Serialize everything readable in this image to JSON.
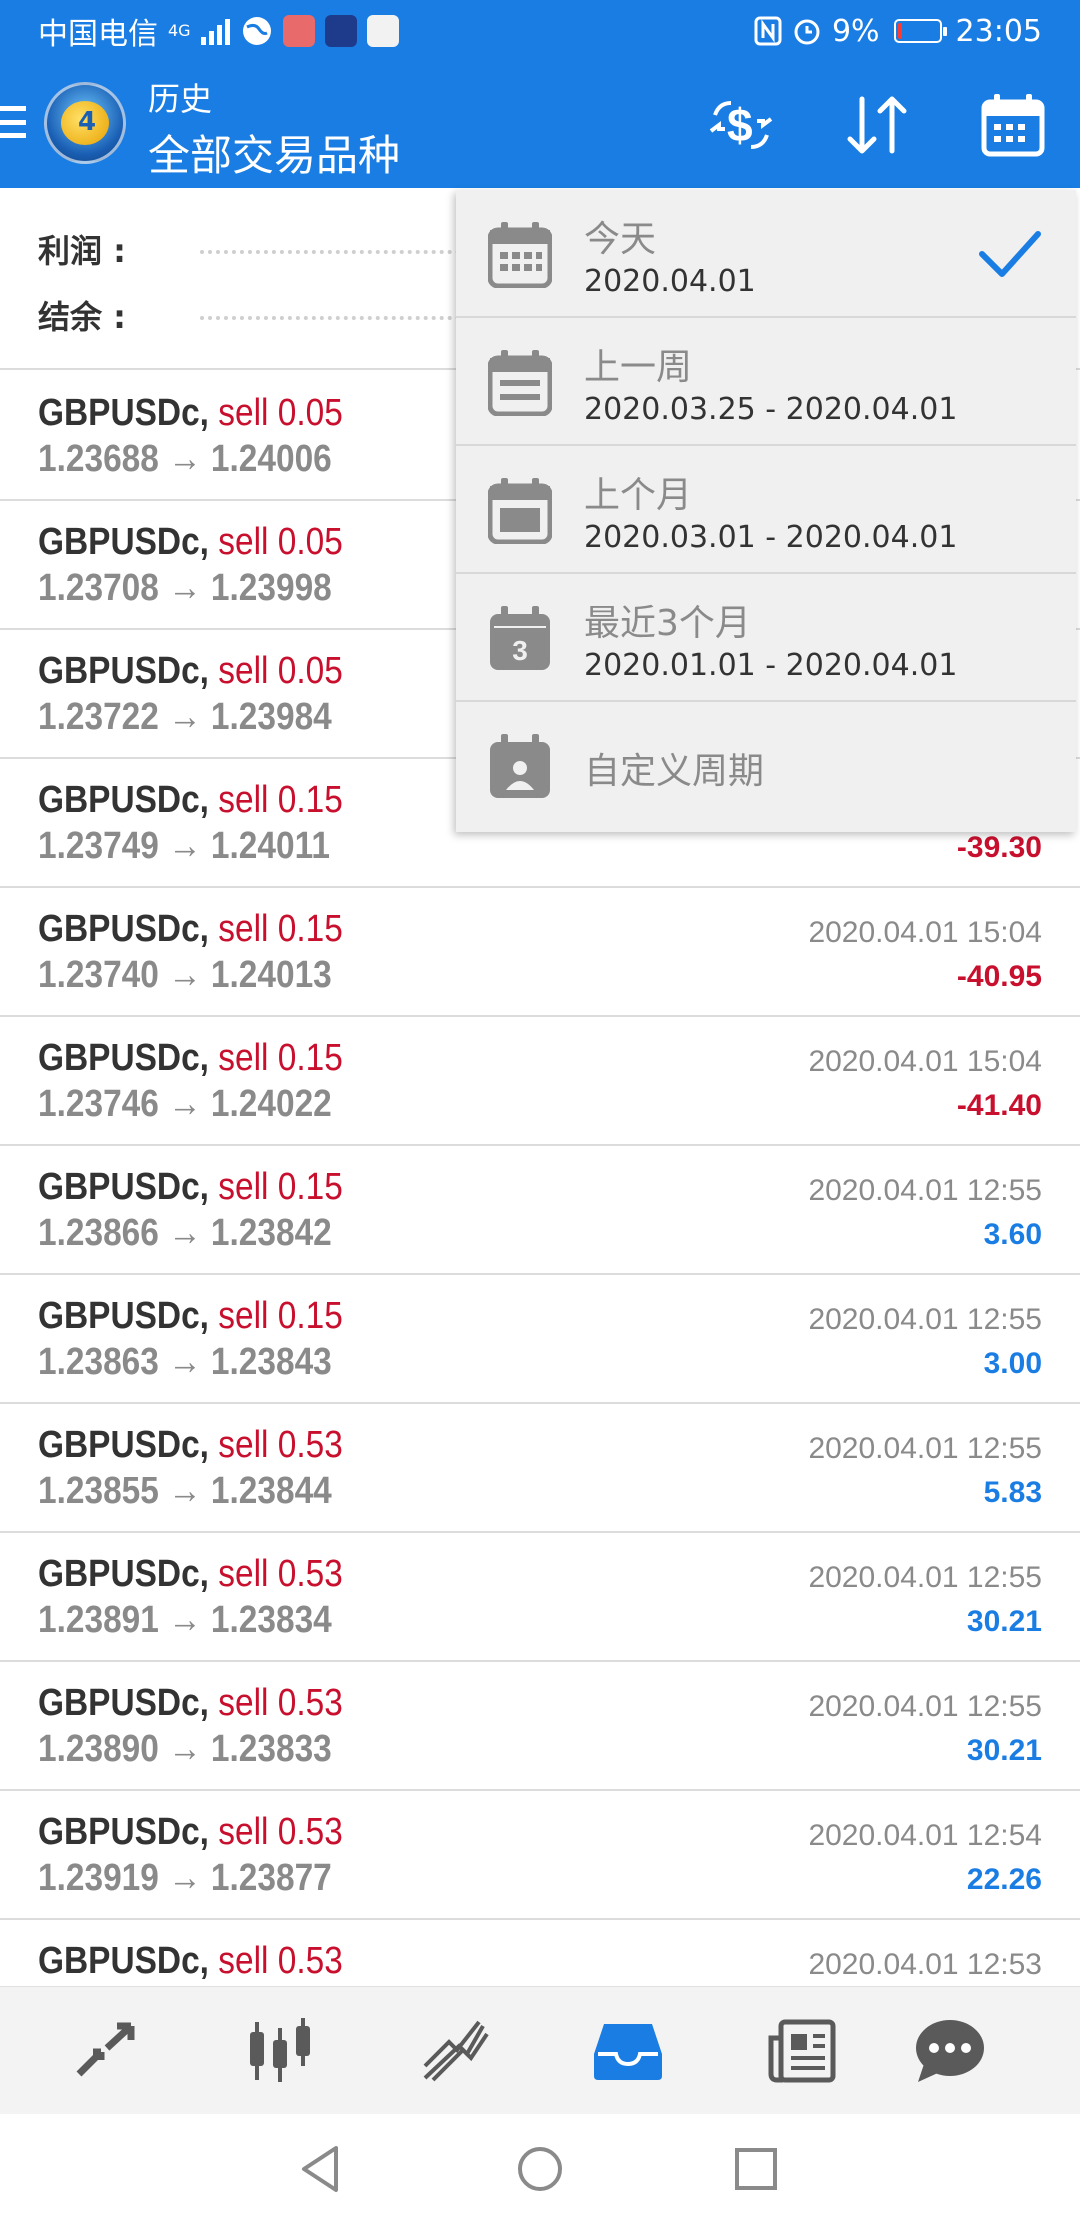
{
  "status_bar": {
    "carrier": "中国电信",
    "network": "4G",
    "battery": "9%",
    "battery_fraction": 0.09,
    "time": "23:05"
  },
  "header": {
    "subtitle": "历史",
    "title": "全部交易品种",
    "icons": [
      "menu-icon",
      "app-logo",
      "currency-filter-icon",
      "sort-icon",
      "calendar-icon"
    ]
  },
  "summary": {
    "profit_label": "利润 :",
    "balance_label": "结余 :"
  },
  "period_menu": {
    "items": [
      {
        "label": "今天",
        "range": "2020.04.01",
        "icon": "calendar-today-icon",
        "selected": true
      },
      {
        "label": "上一周",
        "range": "2020.03.25 - 2020.04.01",
        "icon": "calendar-week-icon"
      },
      {
        "label": "上个月",
        "range": "2020.03.01 - 2020.04.01",
        "icon": "calendar-month-icon"
      },
      {
        "label": "最近3个月",
        "range": "2020.01.01 - 2020.04.01",
        "icon": "calendar-3-months-icon",
        "icon_number": "3"
      },
      {
        "label": "自定义周期",
        "range": "",
        "icon": "calendar-custom-icon"
      }
    ]
  },
  "trades": [
    {
      "symbol": "GBPUSDc,",
      "side": "sell 0.05",
      "prices": "1.23688 → 1.24006",
      "time": "",
      "profit": ""
    },
    {
      "symbol": "GBPUSDc,",
      "side": "sell 0.05",
      "prices": "1.23708 → 1.23998",
      "time": "",
      "profit": ""
    },
    {
      "symbol": "GBPUSDc,",
      "side": "sell 0.05",
      "prices": "1.23722 → 1.23984",
      "time": "",
      "profit": ""
    },
    {
      "symbol": "GBPUSDc,",
      "side": "sell 0.15",
      "prices": "1.23749 → 1.24011",
      "time": "",
      "profit": "-39.30"
    },
    {
      "symbol": "GBPUSDc,",
      "side": "sell 0.15",
      "prices": "1.23740 → 1.24013",
      "time": "2020.04.01 15:04",
      "profit": "-40.95"
    },
    {
      "symbol": "GBPUSDc,",
      "side": "sell 0.15",
      "prices": "1.23746 → 1.24022",
      "time": "2020.04.01 15:04",
      "profit": "-41.40"
    },
    {
      "symbol": "GBPUSDc,",
      "side": "sell 0.15",
      "prices": "1.23866 → 1.23842",
      "time": "2020.04.01 12:55",
      "profit": "3.60"
    },
    {
      "symbol": "GBPUSDc,",
      "side": "sell 0.15",
      "prices": "1.23863 → 1.23843",
      "time": "2020.04.01 12:55",
      "profit": "3.00"
    },
    {
      "symbol": "GBPUSDc,",
      "side": "sell 0.53",
      "prices": "1.23855 → 1.23844",
      "time": "2020.04.01 12:55",
      "profit": "5.83"
    },
    {
      "symbol": "GBPUSDc,",
      "side": "sell 0.53",
      "prices": "1.23891 → 1.23834",
      "time": "2020.04.01 12:55",
      "profit": "30.21"
    },
    {
      "symbol": "GBPUSDc,",
      "side": "sell 0.53",
      "prices": "1.23890 → 1.23833",
      "time": "2020.04.01 12:55",
      "profit": "30.21"
    },
    {
      "symbol": "GBPUSDc,",
      "side": "sell 0.53",
      "prices": "1.23919 → 1.23877",
      "time": "2020.04.01 12:54",
      "profit": "22.26"
    },
    {
      "symbol": "GBPUSDc,",
      "side": "sell 0.53",
      "prices": "",
      "time": "2020.04.01 12:53",
      "profit": ""
    }
  ],
  "bottom_nav": {
    "items": [
      {
        "icon": "quotes-arrows-icon",
        "active": false
      },
      {
        "icon": "candlestick-chart-icon",
        "active": false
      },
      {
        "icon": "trade-line-icon",
        "active": false
      },
      {
        "icon": "history-inbox-icon",
        "active": true
      },
      {
        "icon": "news-icon",
        "active": false
      },
      {
        "icon": "chat-bubble-icon",
        "active": false
      }
    ]
  },
  "system_nav": {
    "icons": [
      "back-icon",
      "home-icon",
      "recents-icon"
    ]
  },
  "colors": {
    "accent": "#1a7de3",
    "sell": "#c8102e",
    "loss": "#c8102e",
    "gain": "#1a7de3",
    "muted_text": "#8a8a8a",
    "menu_bg": "#f0f0f0"
  }
}
